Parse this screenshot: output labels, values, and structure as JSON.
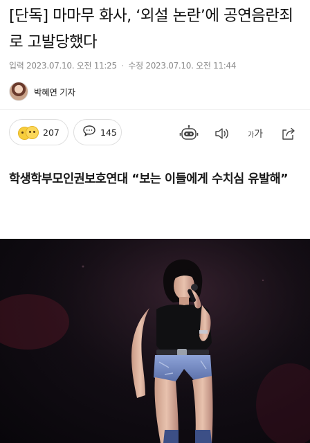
{
  "article": {
    "headline": "[단독] 마마무 화사, ‘외설 논란’에 공연음란죄로 고발당했다",
    "input_label": "입력",
    "input_date": "2023.07.10. 오전 11:25",
    "edit_label": "수정",
    "edit_date": "2023.07.10. 오전 11:44",
    "author": "박혜연 기자",
    "subheadline": "학생학부모인권보호연대 “보는 이들에게 수치심 유발해”"
  },
  "reactions": {
    "count": "207",
    "comment_count": "145"
  },
  "toolbar": {
    "font_small": "가",
    "font_large": "가"
  },
  "colors": {
    "text": "#111111",
    "meta": "#8a8a8a",
    "border": "#dedede",
    "photo_bg": "#120d14"
  },
  "icons": [
    "emoji-reaction-icon",
    "comment-icon",
    "robot-summary-icon",
    "speaker-icon",
    "font-size-icon",
    "share-icon"
  ]
}
